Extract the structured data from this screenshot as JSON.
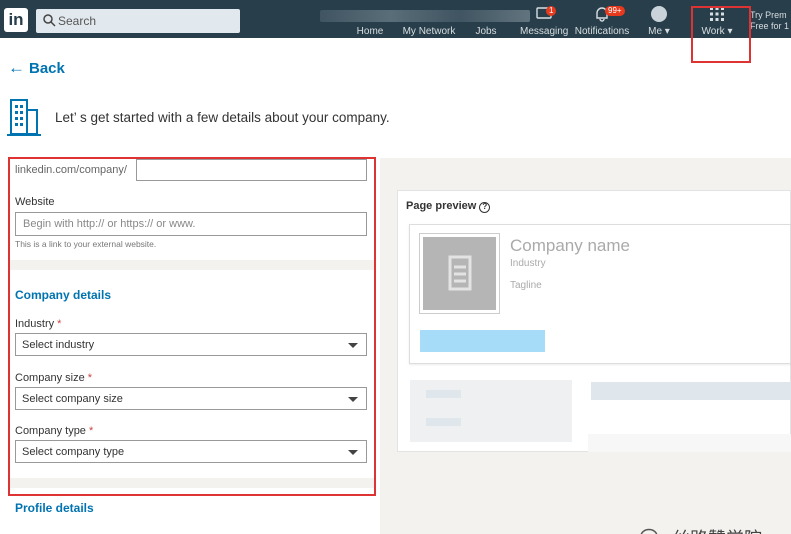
{
  "nav": {
    "logo": "in",
    "search_label": "Search",
    "items": [
      {
        "label": "Home"
      },
      {
        "label": "My Network"
      },
      {
        "label": "Jobs"
      },
      {
        "label": "Messaging",
        "badge": "1"
      },
      {
        "label": "Notifications",
        "badge": "99+"
      },
      {
        "label": "Me ▾"
      },
      {
        "label": "Work ▾"
      }
    ],
    "premium": "Try Prem\nFree for 1"
  },
  "page": {
    "back_label": "Back",
    "intro": "Let’ s get started with a few details about your company."
  },
  "form": {
    "url_prefix": "linkedin.com/company/",
    "website_label": "Website",
    "website_placeholder": "Begin with http:// or https:// or www.",
    "website_help": "This is a link to your external website.",
    "company_details_title": "Company details",
    "industry_label": "Industry",
    "industry_value": "Select industry",
    "size_label": "Company size",
    "size_value": "Select company size",
    "type_label": "Company type",
    "type_value": "Select company type",
    "required_mark": "*",
    "profile_details_title": "Profile details"
  },
  "preview": {
    "title": "Page preview",
    "help_glyph": "?",
    "company_name": "Company name",
    "industry": "Industry",
    "tagline": "Tagline"
  },
  "watermark": "丝路赞学院",
  "colors": {
    "nav_bg": "#283e4a",
    "link_blue": "#0073b1",
    "highlight_red": "#dd3333",
    "preview_button": "#a6dcf7"
  }
}
